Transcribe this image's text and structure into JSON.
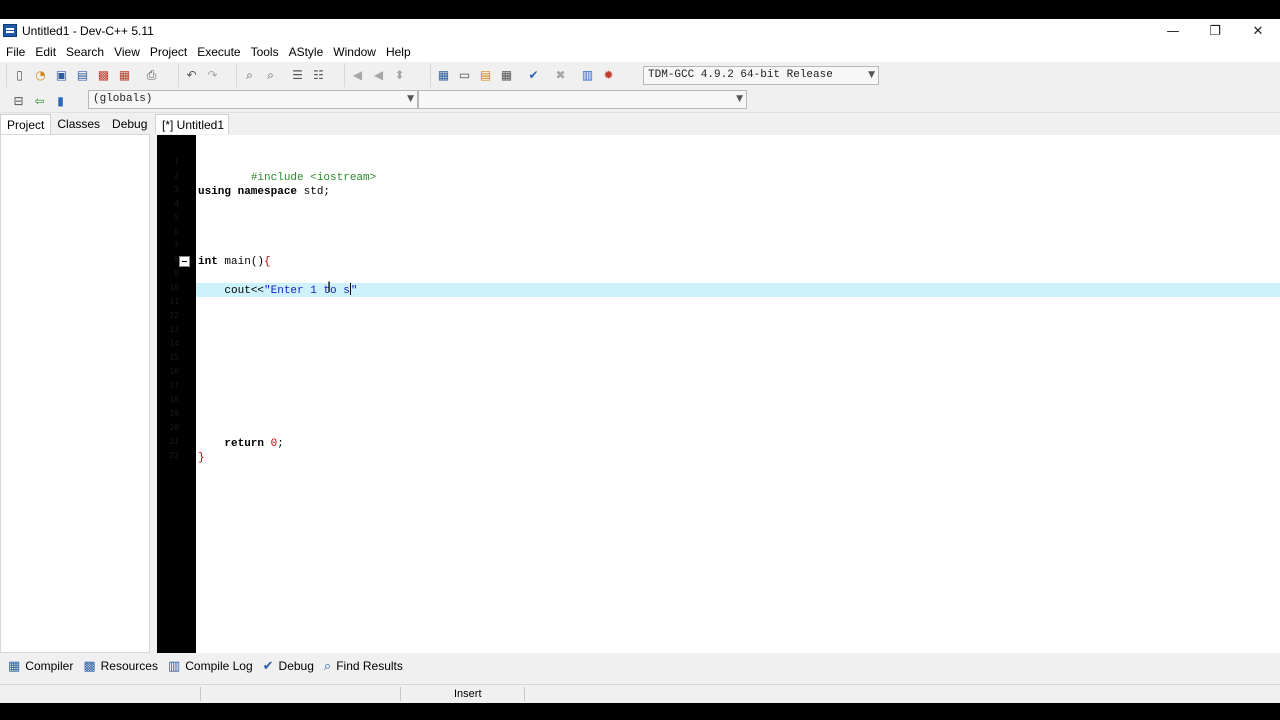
{
  "window": {
    "title": "Untitled1 - Dev-C++ 5.11"
  },
  "window_controls": {
    "minimize": "—",
    "restore": "❐",
    "close": "✕"
  },
  "menu": [
    "File",
    "Edit",
    "Search",
    "View",
    "Project",
    "Execute",
    "Tools",
    "AStyle",
    "Window",
    "Help"
  ],
  "toolbar": {
    "compiler_select": "TDM-GCC 4.9.2 64-bit Release",
    "globals_select": "(globals)",
    "members_select": ""
  },
  "left_panel": {
    "tabs": [
      "Project",
      "Classes",
      "Debug"
    ],
    "active_tab": "Project"
  },
  "editor": {
    "tab_label": "[*] Untitled1",
    "line_numbers": [
      "1",
      "2",
      "3",
      "4",
      "5",
      "6",
      "7",
      "8",
      "9",
      "10",
      "11",
      "12",
      "13",
      "14",
      "15",
      "16",
      "17",
      "18",
      "19",
      "20",
      "21",
      "22"
    ],
    "lines": {
      "l1_directive": "#include <iostream>",
      "l3_kw": "using namespace",
      "l3_rest": " std;",
      "l8_kw": "int",
      "l8_rest": " main()",
      "l8_brace": "{",
      "l10_plain": "    cout<<",
      "l10_string": "\"Enter 1 to s",
      "l10_string_end": "\"",
      "l21_kw": "    return",
      "l21_num": " 0",
      "l21_semi": ";",
      "l22_brace": "}"
    }
  },
  "bottom_tabs": [
    {
      "label": "Compiler",
      "icon": "grid-icon"
    },
    {
      "label": "Resources",
      "icon": "resources-icon"
    },
    {
      "label": "Compile Log",
      "icon": "chart-icon"
    },
    {
      "label": "Debug",
      "icon": "check-icon"
    },
    {
      "label": "Find Results",
      "icon": "search-doc-icon"
    }
  ],
  "status_bar": {
    "mode": "Insert"
  }
}
